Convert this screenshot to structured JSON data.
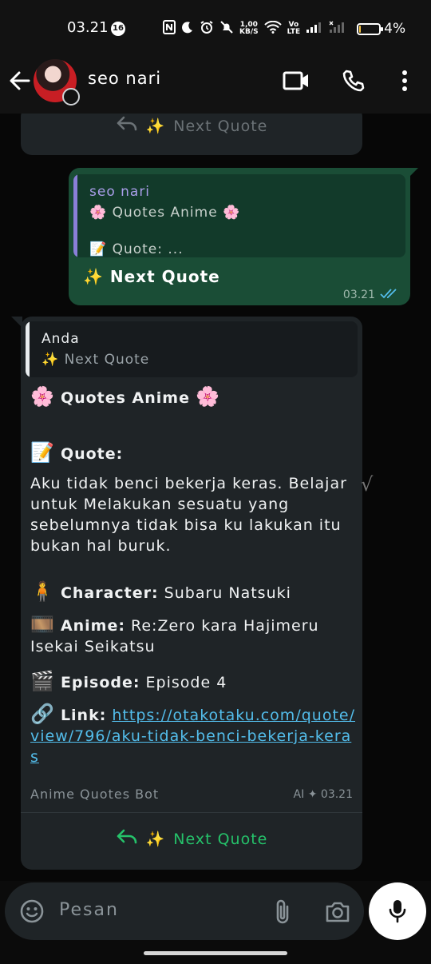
{
  "status_bar": {
    "time": "03.21",
    "notification_count": "16",
    "net_speed_top": "1,00",
    "net_speed_bottom": "KB/S",
    "volte_top": "Vo",
    "volte_bottom": "LTE",
    "battery_percent": "4%",
    "battery_level": 0.04,
    "battery_color": "#f5c242"
  },
  "header": {
    "contact_name": "seo nari"
  },
  "messages": {
    "top_partial_button": "Next Quote",
    "outgoing": {
      "quoted_name": "seo nari",
      "quoted_line1": "Quotes Anime",
      "quoted_line2": "Quote: ...",
      "text": "Next Quote",
      "time": "03.21"
    },
    "incoming": {
      "quoted_name": "Anda",
      "quoted_text": "Next Quote",
      "title": "Quotes Anime",
      "quote_label": "Quote:",
      "quote_body": "Aku tidak benci bekerja keras. Belajar untuk Melakukan sesuatu yang sebelumnya tidak bisa ku lakukan itu bukan hal buruk.",
      "character_label": "Character:",
      "character_value": "Subaru Natsuki",
      "anime_label": "Anime:",
      "anime_value": "Re:Zero kara Hajimeru Isekai Seikatsu",
      "episode_label": "Episode:",
      "episode_value": "Episode 4",
      "link_label": "Link:",
      "link_value": "https://otakotaku.com/quote/view/796/aku-tidak-benci-bekerja-keras",
      "sender_footer": "Anime Quotes Bot",
      "ai_label": "AI",
      "time": "03.21",
      "button": "Next Quote"
    }
  },
  "input": {
    "placeholder": "Pesan"
  },
  "colors": {
    "outgoing_bubble": "#1a4d36",
    "incoming_bubble": "#1f2427",
    "link": "#53bdeb",
    "button_green": "#25c26a"
  }
}
